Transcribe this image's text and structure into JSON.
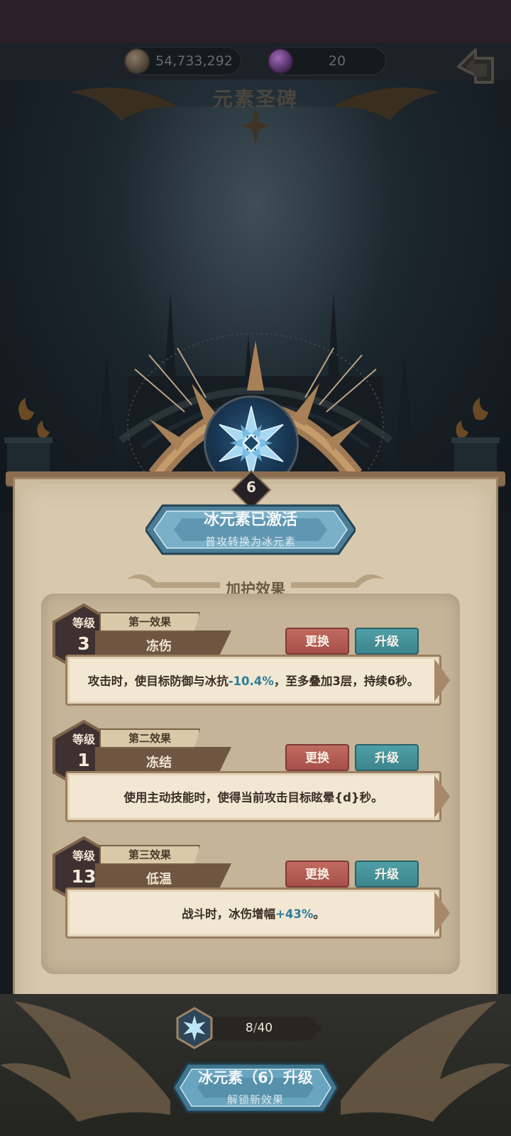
{
  "currency": {
    "gold": "54,733,292",
    "gems": "20"
  },
  "page_title": "元素圣碑",
  "element": {
    "level": "6"
  },
  "active_banner": {
    "title": "冰元素已激活",
    "subtitle": "普攻转换为冰元素"
  },
  "section_heading": "加护效果",
  "effects": [
    {
      "level_label": "等级",
      "level": "3",
      "slot": "第一效果",
      "name": "冻伤",
      "swap_label": "更换",
      "upgrade_label": "升级",
      "desc_before": "攻击时，使目标防御与冰抗",
      "desc_value": "-10.4%",
      "desc_after": "，至多叠加3层，持续6秒。"
    },
    {
      "level_label": "等级",
      "level": "1",
      "slot": "第二效果",
      "name": "冻结",
      "swap_label": "更换",
      "upgrade_label": "升级",
      "desc_before": "使用主动技能时，使得当前攻击目标眩晕{d}秒。",
      "desc_value": "",
      "desc_after": ""
    },
    {
      "level_label": "等级",
      "level": "13",
      "slot": "第三效果",
      "name": "低温",
      "swap_label": "更换",
      "upgrade_label": "升级",
      "desc_before": "战斗时，冰伤增幅",
      "desc_value": "+43%",
      "desc_after": "。"
    }
  ],
  "progress": {
    "current": "8",
    "max": "40",
    "separator": "/"
  },
  "upgrade_button": {
    "title": "冰元素（6）升级",
    "subtitle": "解锁新效果"
  },
  "colors": {
    "ice_accent": "#2c7c9a",
    "swap_button": "#b45c54",
    "upgrade_button": "#4793a0",
    "parchment": "#d8c9ae"
  }
}
